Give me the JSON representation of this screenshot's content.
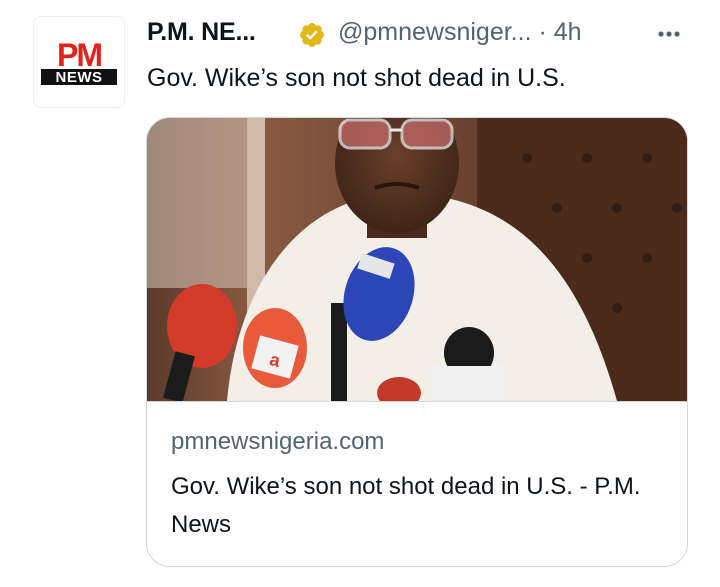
{
  "account": {
    "display_name": "P.M. NE...",
    "handle_time": "@pmnewsniger... · 4h",
    "avatar_logo": {
      "top": "PM",
      "bottom": "NEWS"
    }
  },
  "tweet": {
    "text": "Gov. Wike’s son not shot dead in U.S."
  },
  "card": {
    "domain": "pmnewsnigeria.com",
    "title": "Gov. Wike’s son not shot dead in U.S. - P.M. News"
  },
  "colors": {
    "accent": "#1d9bf0",
    "verified": "#e2b719",
    "muted": "#536471",
    "border": "#cfd9de",
    "logo_red": "#e2231a"
  },
  "icons": {
    "verified": "verified-badge-icon",
    "more": "more-horizontal-icon"
  }
}
